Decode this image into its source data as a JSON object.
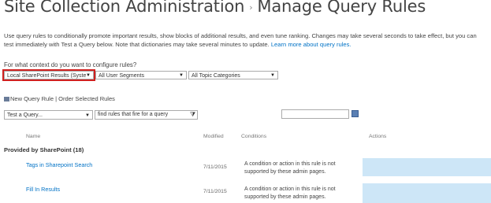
{
  "header": {
    "site": "Site Collection Administration",
    "separator": "›",
    "page": "Manage Query Rules"
  },
  "description": {
    "text": "Use query rules to conditionally promote important results, show blocks of additional results, and even tune ranking. Changes may take several seconds to take effect, but you can test immediately with Test a Query below. Note that dictionaries may take several minutes to update.",
    "link": "Learn more about query rules."
  },
  "context": {
    "question": "For what context do you want to configure rules?",
    "source": "Local SharePoint Results (Syste",
    "segments": "All User Segments",
    "topics": "All Topic Categories"
  },
  "toolbar": {
    "new_rule": "New Query Rule",
    "divider": "|",
    "order": "Order Selected Rules"
  },
  "filters": {
    "test_query": "Test a Query...",
    "find_rules": "find rules that fire for a query",
    "date_value": ""
  },
  "columns": {
    "name": "Name",
    "modified": "Modified",
    "conditions": "Conditions",
    "actions": "Actions"
  },
  "group": {
    "label": "Provided by SharePoint (18)"
  },
  "rows": [
    {
      "name": "Tags in Sharepoint Search",
      "modified": "7/11/2015",
      "condition_line1": "A condition or action in this rule is not",
      "condition_line2": "supported by these admin pages."
    },
    {
      "name": "Fill In Results",
      "modified": "7/11/2015",
      "condition_line1": "A condition or action in this rule is not",
      "condition_line2": "supported by these admin pages."
    }
  ],
  "colors": {
    "link": "#0072c6",
    "highlight": "#d0201f",
    "action_box": "#cde6f7"
  },
  "icons": [
    "new-rule-icon",
    "dropdown-arrow-icon",
    "filter-funnel-icon",
    "calendar-icon"
  ]
}
